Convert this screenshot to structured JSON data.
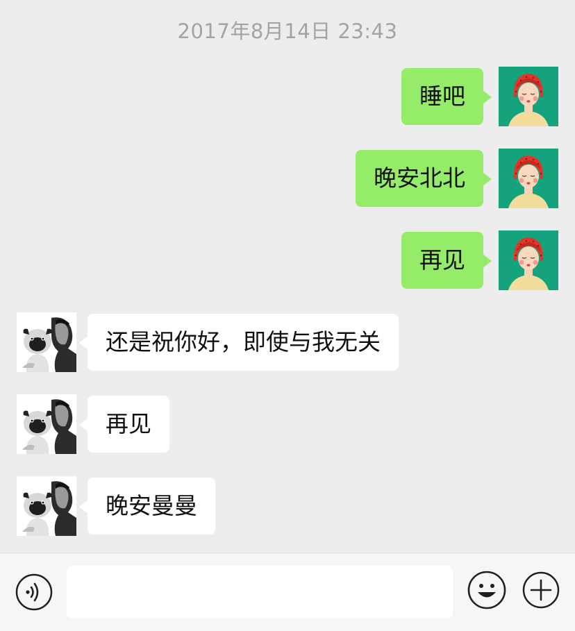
{
  "chat": {
    "timestamp": "2017年8月14日 23:43",
    "messages": [
      {
        "side": "out",
        "text": "睡吧"
      },
      {
        "side": "out",
        "text": "晚安北北"
      },
      {
        "side": "out",
        "text": "再见"
      },
      {
        "side": "in",
        "text": "还是祝你好，即使与我无关"
      },
      {
        "side": "in",
        "text": "再见"
      },
      {
        "side": "in",
        "text": "晚安曼曼"
      }
    ]
  },
  "input_bar": {
    "voice_icon": "voice-icon",
    "emoji_icon": "emoji-icon",
    "add_icon": "plus-icon",
    "text_value": ""
  },
  "colors": {
    "background": "#ededed",
    "outgoing_bubble": "#95ec69",
    "incoming_bubble": "#ffffff",
    "timestamp_text": "#a3a3a3"
  }
}
